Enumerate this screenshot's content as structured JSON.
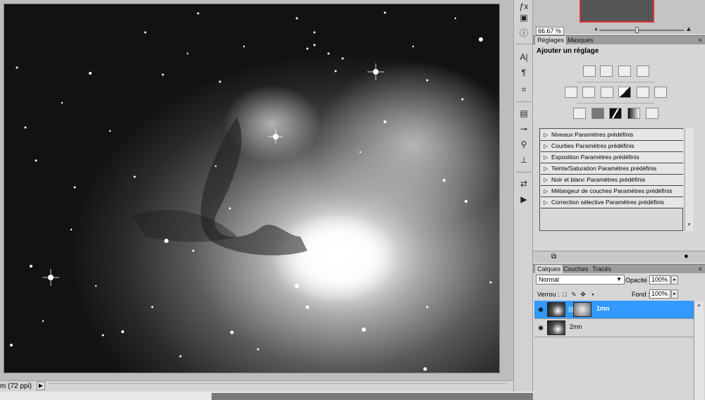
{
  "status_bar": {
    "zoom_text": "m (72 ppi)",
    "arrow": "▶"
  },
  "navigator": {
    "zoom_value": "66.67 %"
  },
  "adjustments_panel": {
    "tabs": [
      "Réglages",
      "Masques"
    ],
    "title": "Ajouter un réglage",
    "icons_row1": [
      "brightness-contrast-icon",
      "levels-icon",
      "curves-icon",
      "exposure-icon"
    ],
    "icons_row2": [
      "vibrance-icon",
      "hue-saturation-icon",
      "color-balance-icon",
      "black-white-icon",
      "photo-filter-icon",
      "channel-mixer-icon"
    ],
    "icons_row3": [
      "invert-icon",
      "posterize-icon",
      "threshold-icon",
      "gradient-map-icon",
      "selective-color-icon"
    ],
    "presets": [
      "Niveaux Paramètres prédéfinis",
      "Courbes Paramètres prédéfinis",
      "Exposition Paramètres prédéfinis",
      "Teinte/Saturation Paramètres prédéfinis",
      "Noir et blanc Paramètres prédéfinis",
      "Mélangeur de couches Paramètres prédéfinis",
      "Correction sélective Paramètres prédéfinis"
    ]
  },
  "layers_panel": {
    "tabs": [
      "Calques",
      "Couches",
      "Tracés"
    ],
    "blend_mode": "Normal",
    "opacity_label": "Opacité :",
    "opacity_value": "100%",
    "lock_label": "Verrou :",
    "fill_label": "Fond :",
    "fill_value": "100%",
    "layers": [
      {
        "name": "1mn",
        "selected": true,
        "visible": true,
        "has_mask": true
      },
      {
        "name": "2mn",
        "selected": false,
        "visible": true,
        "has_mask": false
      }
    ]
  },
  "colors": {
    "selection": "#3399ff",
    "navigator_frame": "#e03030"
  }
}
